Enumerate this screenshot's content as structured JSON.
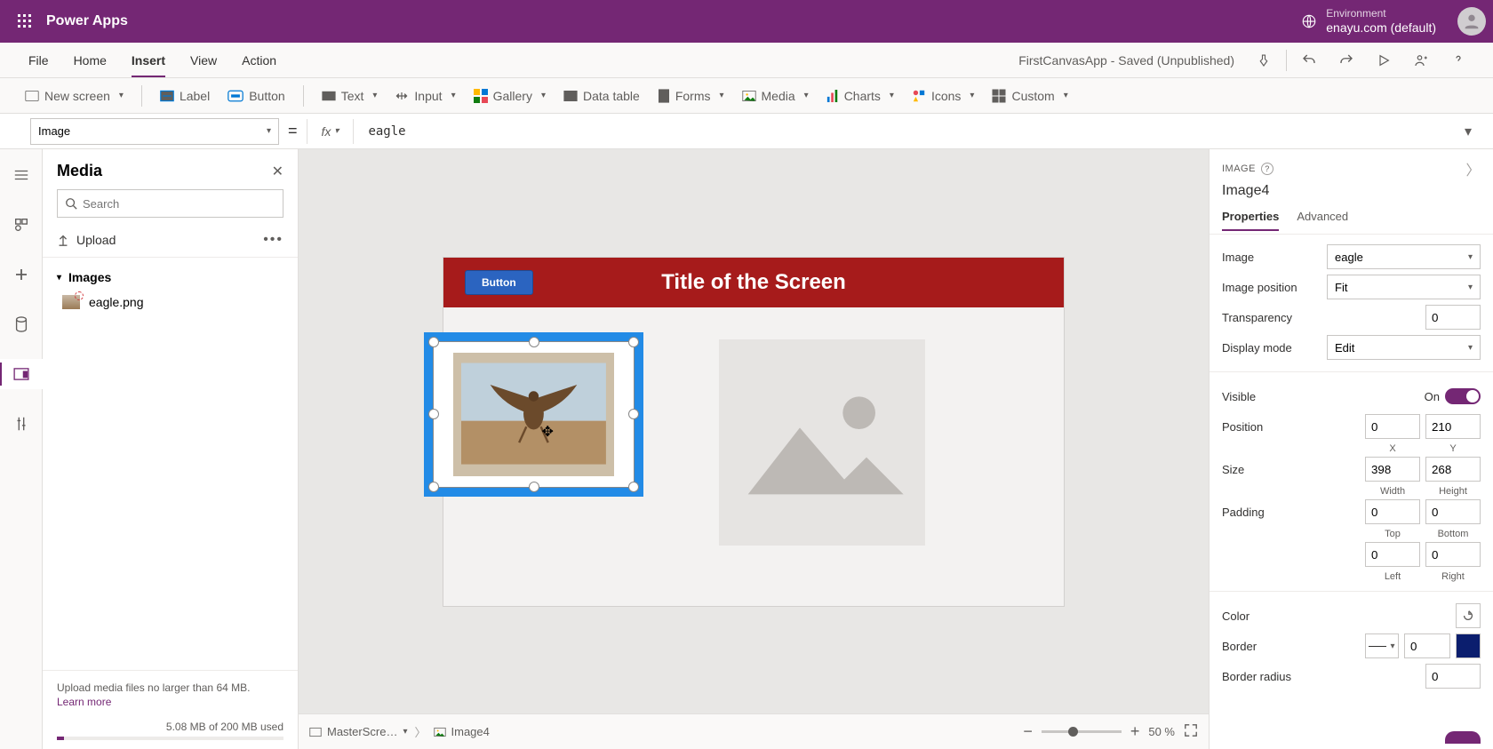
{
  "top": {
    "appTitle": "Power Apps",
    "envLabel": "Environment",
    "envValue": "enayu.com (default)"
  },
  "menu": {
    "items": [
      "File",
      "Home",
      "Insert",
      "View",
      "Action"
    ],
    "activeIndex": 2,
    "status": "FirstCanvasApp - Saved (Unpublished)"
  },
  "ribbon": {
    "newScreen": "New screen",
    "label": "Label",
    "button": "Button",
    "text": "Text",
    "input": "Input",
    "gallery": "Gallery",
    "dataTable": "Data table",
    "forms": "Forms",
    "media": "Media",
    "charts": "Charts",
    "icons": "Icons",
    "custom": "Custom"
  },
  "formula": {
    "property": "Image",
    "fx": "fx",
    "value": "eagle"
  },
  "media": {
    "title": "Media",
    "searchPlaceholder": "Search",
    "upload": "Upload",
    "sections": {
      "images": "Images"
    },
    "items": [
      "eagle.png"
    ],
    "footerText": "Upload media files no larger than 64 MB.",
    "learnMore": "Learn more",
    "usage": "5.08 MB of 200 MB used"
  },
  "canvas": {
    "screenTitle": "Title of the Screen",
    "buttonLabel": "Button"
  },
  "crumbs": {
    "screen": "MasterScre…",
    "item": "Image4",
    "zoom": "50  %"
  },
  "properties": {
    "typeLabel": "IMAGE",
    "name": "Image4",
    "tabs": [
      "Properties",
      "Advanced"
    ],
    "activeTab": 0,
    "labels": {
      "image": "Image",
      "imagePosition": "Image position",
      "transparency": "Transparency",
      "displayMode": "Display mode",
      "visible": "Visible",
      "position": "Position",
      "size": "Size",
      "padding": "Padding",
      "color": "Color",
      "border": "Border",
      "borderRadius": "Border radius",
      "on": "On",
      "x": "X",
      "y": "Y",
      "width": "Width",
      "height": "Height",
      "top": "Top",
      "bottom": "Bottom",
      "left": "Left",
      "right": "Right"
    },
    "values": {
      "image": "eagle",
      "imagePosition": "Fit",
      "transparency": "0",
      "displayMode": "Edit",
      "x": "0",
      "y": "210",
      "w": "398",
      "h": "268",
      "padTop": "0",
      "padBottom": "0",
      "padLeft": "0",
      "padRight": "0",
      "border": "0",
      "borderRadius": "0"
    }
  }
}
